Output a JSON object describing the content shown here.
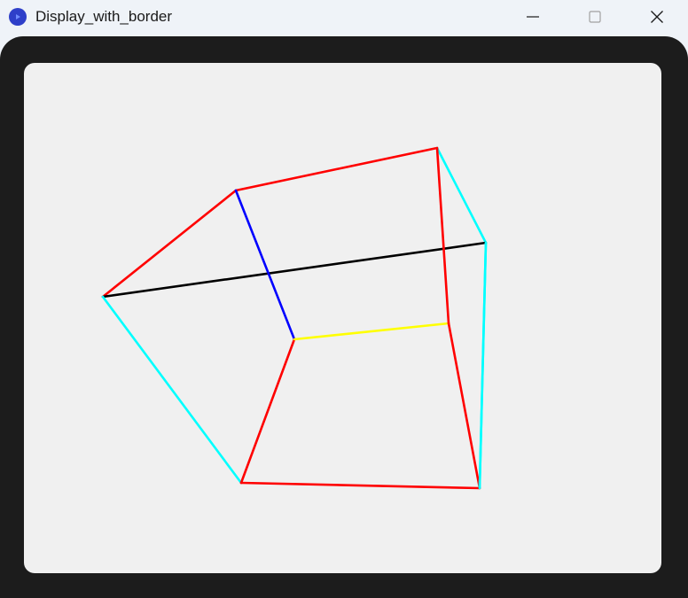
{
  "window": {
    "title": "Display_with_border"
  },
  "icons": {
    "app": "app-play-icon",
    "minimize": "minimize-icon",
    "maximize": "maximize-icon",
    "close": "close-icon"
  },
  "colors": {
    "titlebar_bg": "#eff3f8",
    "border": "#1c1c1c",
    "canvas_bg": "#f0f0f0",
    "app_icon": "#2e3fc9",
    "edge_red": "#ff0000",
    "edge_cyan": "#00ffff",
    "edge_blue": "#0000ff",
    "edge_black": "#000000",
    "edge_yellow": "#ffff00"
  },
  "wireframe": {
    "edges": [
      {
        "name": "edge-red-1",
        "color": "#ff0000"
      },
      {
        "name": "edge-red-2",
        "color": "#ff0000"
      },
      {
        "name": "edge-cyan-1",
        "color": "#00ffff"
      },
      {
        "name": "edge-black-1",
        "color": "#000000"
      },
      {
        "name": "edge-cyan-2",
        "color": "#00ffff"
      },
      {
        "name": "edge-blue-1",
        "color": "#0000ff"
      },
      {
        "name": "edge-red-3",
        "color": "#ff0000"
      },
      {
        "name": "edge-yellow-1",
        "color": "#ffff00"
      },
      {
        "name": "edge-red-4",
        "color": "#ff0000"
      },
      {
        "name": "edge-red-5",
        "color": "#ff0000"
      },
      {
        "name": "edge-cyan-3",
        "color": "#00ffff"
      },
      {
        "name": "edge-red-6",
        "color": "#ff0000"
      },
      {
        "name": "edge-cyan-4",
        "color": "#00ffff"
      }
    ]
  }
}
